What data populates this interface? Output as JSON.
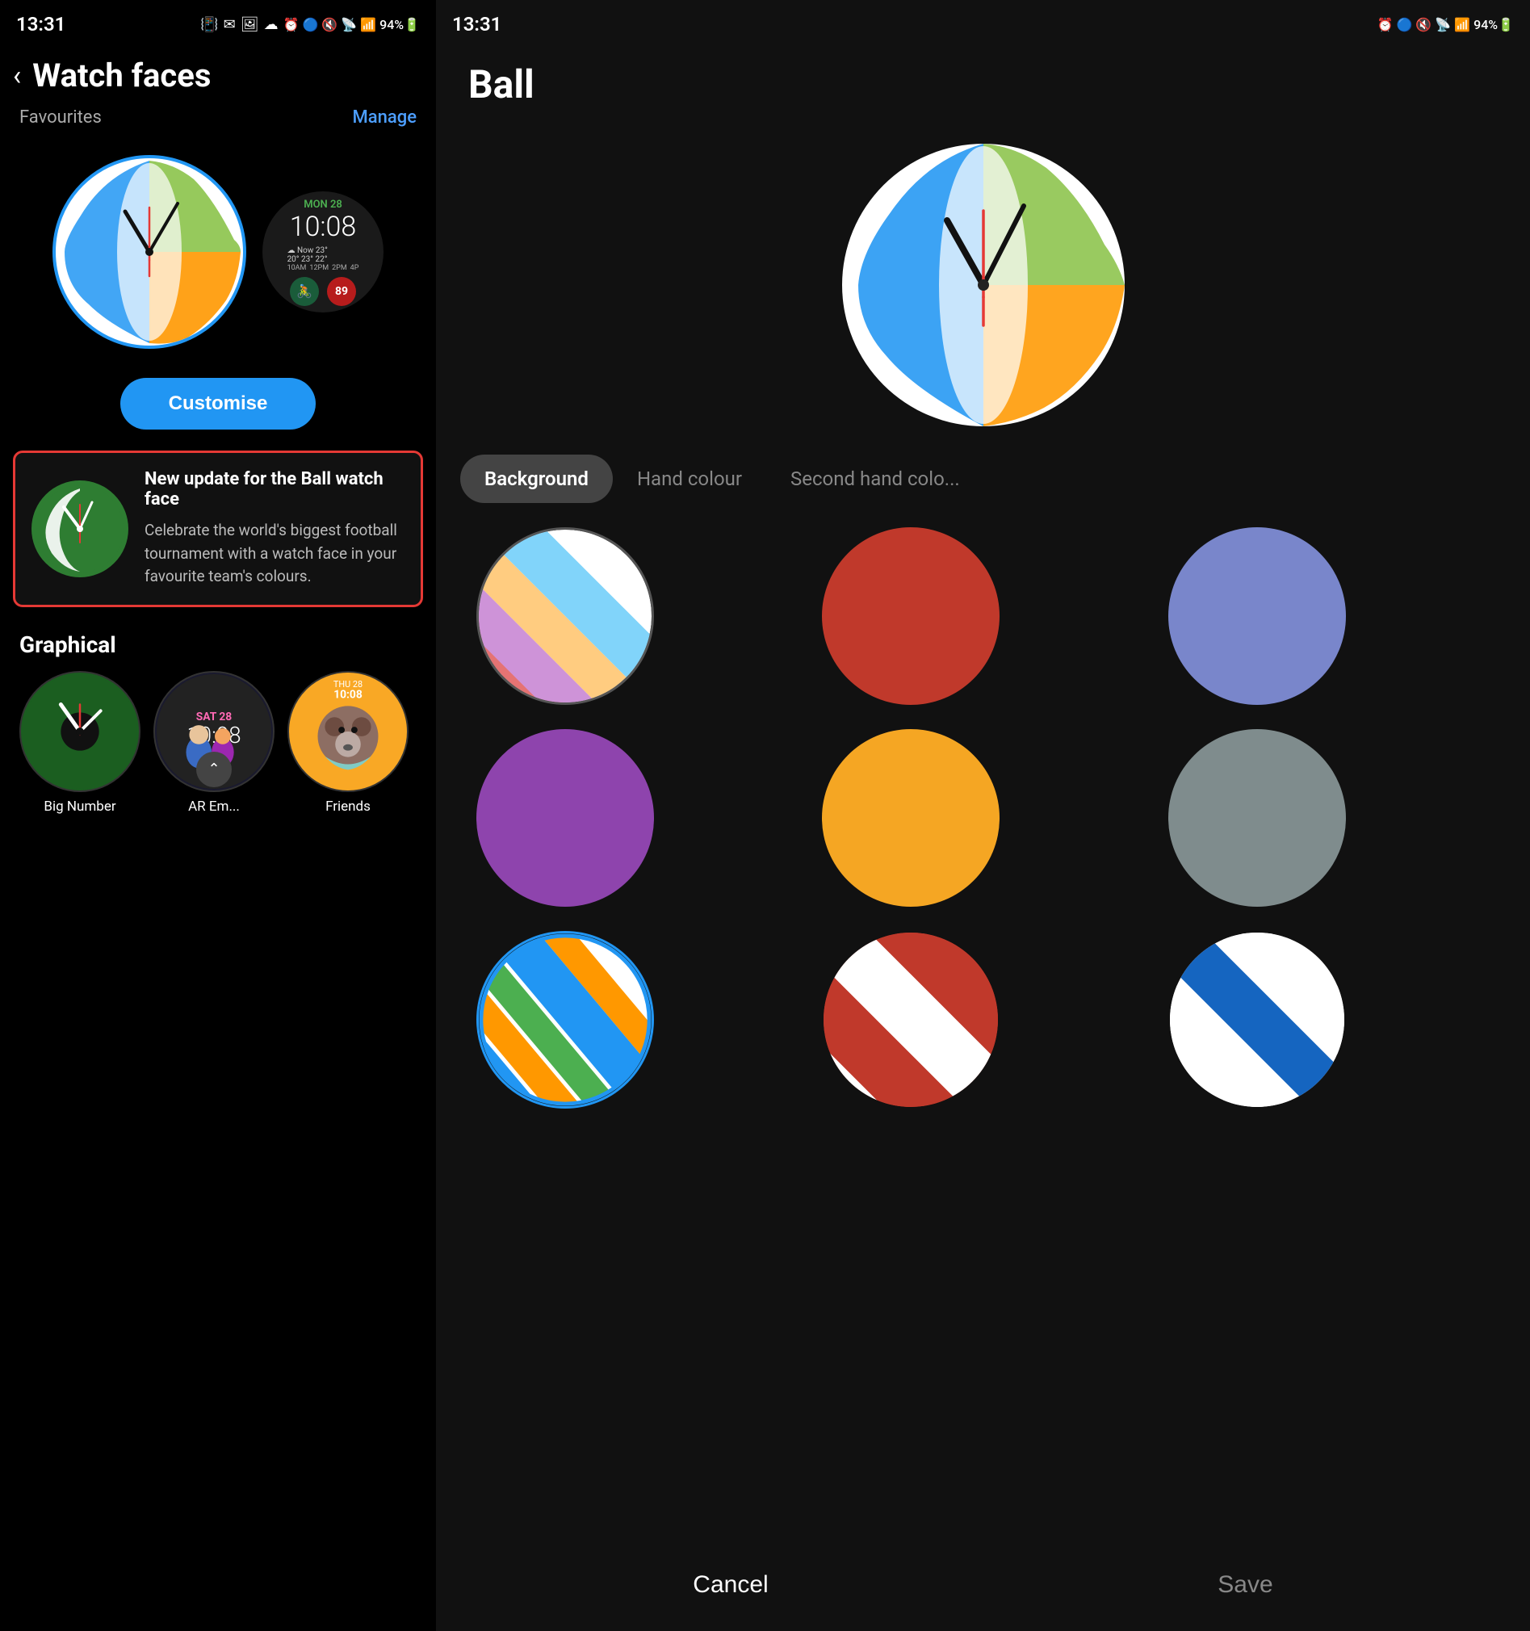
{
  "left": {
    "statusBar": {
      "time": "13:31",
      "icons": "🔔 ✉ 🖼 ☁  ⏰ 🔵 🔇 📶 📶 94% 🔋"
    },
    "backLabel": "‹",
    "pageTitle": "Watch faces",
    "favouritesLabel": "Favourites",
    "manageLabel": "Manage",
    "customiseLabel": "Customise",
    "updateBanner": {
      "title": "New update for the Ball watch face",
      "description": "Celebrate the world's biggest football tournament with a watch face in your favourite team's colours."
    },
    "graphical": {
      "title": "Graphical",
      "faces": [
        {
          "label": "Big Number"
        },
        {
          "label": "AR Em..."
        },
        {
          "label": "Friends"
        }
      ]
    },
    "secondaryWatch": {
      "date": "MON 28",
      "time": "10:08",
      "temp": "Now 23°",
      "forecast": "20° 23° 22°",
      "times": "10AM 12PM 2PM 4P"
    }
  },
  "right": {
    "statusBar": {
      "time": "13:31",
      "icons": "🔔 ✉ 🖼 ☁  ⏰ 🔵 🔇 📶 📶 94% 🔋"
    },
    "title": "Ball",
    "tabs": [
      {
        "label": "Background",
        "active": true
      },
      {
        "label": "Hand colour",
        "active": false
      },
      {
        "label": "Second hand colo...",
        "active": false
      }
    ],
    "colors": [
      {
        "type": "stripe",
        "colors": [
          "#e57373",
          "#ce93d8",
          "#ffcc80",
          "#81d4fa"
        ],
        "selected": false
      },
      {
        "type": "solid",
        "color": "#c0392b",
        "selected": false
      },
      {
        "type": "solid",
        "color": "#7986cb",
        "selected": false
      },
      {
        "type": "solid",
        "color": "#8e44ad",
        "selected": false
      },
      {
        "type": "solid",
        "color": "#f5a623",
        "selected": false
      },
      {
        "type": "solid",
        "color": "#7f8c8d",
        "selected": false
      },
      {
        "type": "stripe2",
        "colors": [
          "#fff",
          "#2196f3",
          "#4caf50",
          "#ff9800"
        ],
        "selected": false
      },
      {
        "type": "stripe3",
        "colors": [
          "#c0392b",
          "#fff"
        ],
        "selected": false
      },
      {
        "type": "stripe4",
        "colors": [
          "#fff",
          "#1565c0"
        ],
        "selected": false
      }
    ],
    "cancelLabel": "Cancel",
    "saveLabel": "Save"
  }
}
